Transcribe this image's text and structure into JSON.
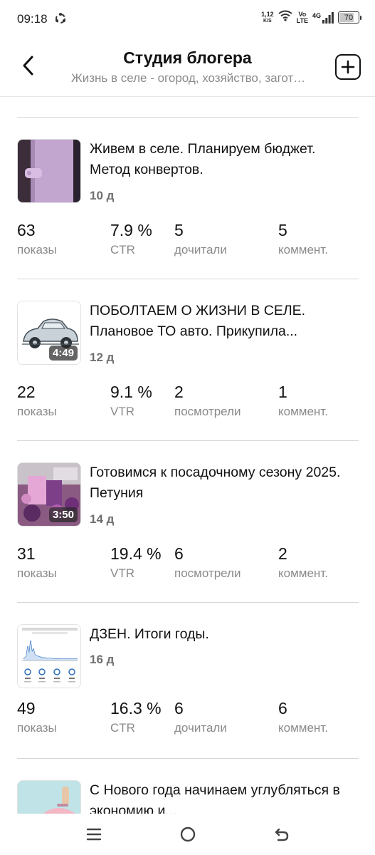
{
  "status_bar": {
    "time": "09:18",
    "speed_value": "1,12",
    "speed_unit": "K/S",
    "volte_top": "Vo",
    "volte_bottom": "LTE",
    "network": "4G",
    "battery": "70",
    "battery_level": 0.7
  },
  "header": {
    "title": "Студия блогера",
    "subtitle": "Жизнь в селе - огород, хозяйство, заготовки"
  },
  "posts": [
    {
      "title": "Живем в селе. Планируем бюджет. Метод конвертов.",
      "age": "10 д",
      "duration": "",
      "thumb_icon": "purple-envelope-wallet",
      "stats": [
        {
          "value": "63",
          "label": "показы"
        },
        {
          "value": "7.9 %",
          "label": "CTR"
        },
        {
          "value": "5",
          "label": "дочитали"
        },
        {
          "value": "5",
          "label": "коммент."
        }
      ]
    },
    {
      "title": "ПОБОЛТАЕМ О ЖИЗНИ В СЕЛЕ. Плановое ТО авто. Прикупила...",
      "age": "12 д",
      "duration": "4:49",
      "thumb_icon": "vintage-car",
      "stats": [
        {
          "value": "22",
          "label": "показы"
        },
        {
          "value": "9.1 %",
          "label": "VTR"
        },
        {
          "value": "2",
          "label": "посмотрели"
        },
        {
          "value": "1",
          "label": "коммент."
        }
      ]
    },
    {
      "title": "Готовимся к посадочному сезону 2025. Петуния",
      "age": "14 д",
      "duration": "3:50",
      "thumb_icon": "petunia-seeds",
      "stats": [
        {
          "value": "31",
          "label": "показы"
        },
        {
          "value": "19.4 %",
          "label": "VTR"
        },
        {
          "value": "6",
          "label": "посмотрели"
        },
        {
          "value": "2",
          "label": "коммент."
        }
      ]
    },
    {
      "title": "ДЗЕН. Итоги годы.",
      "age": "16 д",
      "duration": "",
      "thumb_icon": "stats-screenshot",
      "stats": [
        {
          "value": "49",
          "label": "показы"
        },
        {
          "value": "16.3 %",
          "label": "CTR"
        },
        {
          "value": "6",
          "label": "дочитали"
        },
        {
          "value": "6",
          "label": "коммент."
        }
      ]
    },
    {
      "title": "С Нового года начинаем углубляться в экономию и...",
      "age": "",
      "duration": "",
      "thumb_icon": "piggy-bank",
      "stats": []
    }
  ],
  "colors": {
    "text": "#111111",
    "muted": "#8a8a8a",
    "divider": "#d6d6d6"
  }
}
